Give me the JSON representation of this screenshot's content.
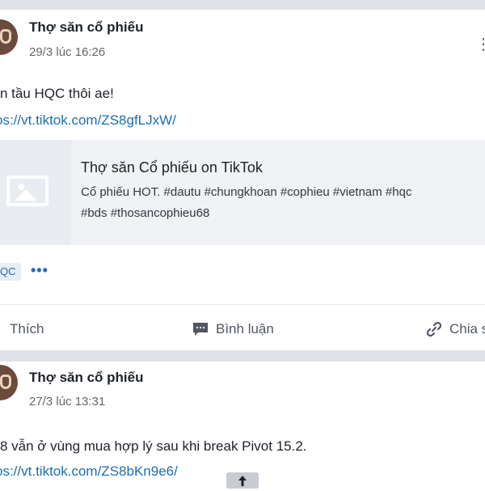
{
  "posts": [
    {
      "author": "Thợ săn cổ phiếu",
      "time": "29/3 lúc 16:26",
      "text": "n tầu HQC thôi ae!",
      "link": "os://vt.tiktok.com/ZS8gfLJxW/",
      "preview": {
        "title": "Thợ săn Cổ phiếu on TikTok",
        "desc_line1": "Cổ phiếu HOT. #dautu #chungkhoan #cophieu #vietnam #hqc",
        "desc_line2": "#bds #thosancophieu68",
        "thumb_icon": "image-placeholder-icon"
      },
      "tag": "QC",
      "actions": {
        "like": "Thích",
        "comment": "Bình luận",
        "share": "Chia s"
      }
    },
    {
      "author": "Thợ săn cổ phiếu",
      "time": "27/3 lúc 13:31",
      "text": "8 vẫn ở vùng mua hợp lý sau khi break Pivot 15.2.",
      "link": "os://vt.tiktok.com/ZS8bKn9e6/"
    }
  ],
  "colors": {
    "link": "#1a6fb0",
    "tag_bg": "#e6eef7",
    "page_bg": "#dfe3e8"
  }
}
